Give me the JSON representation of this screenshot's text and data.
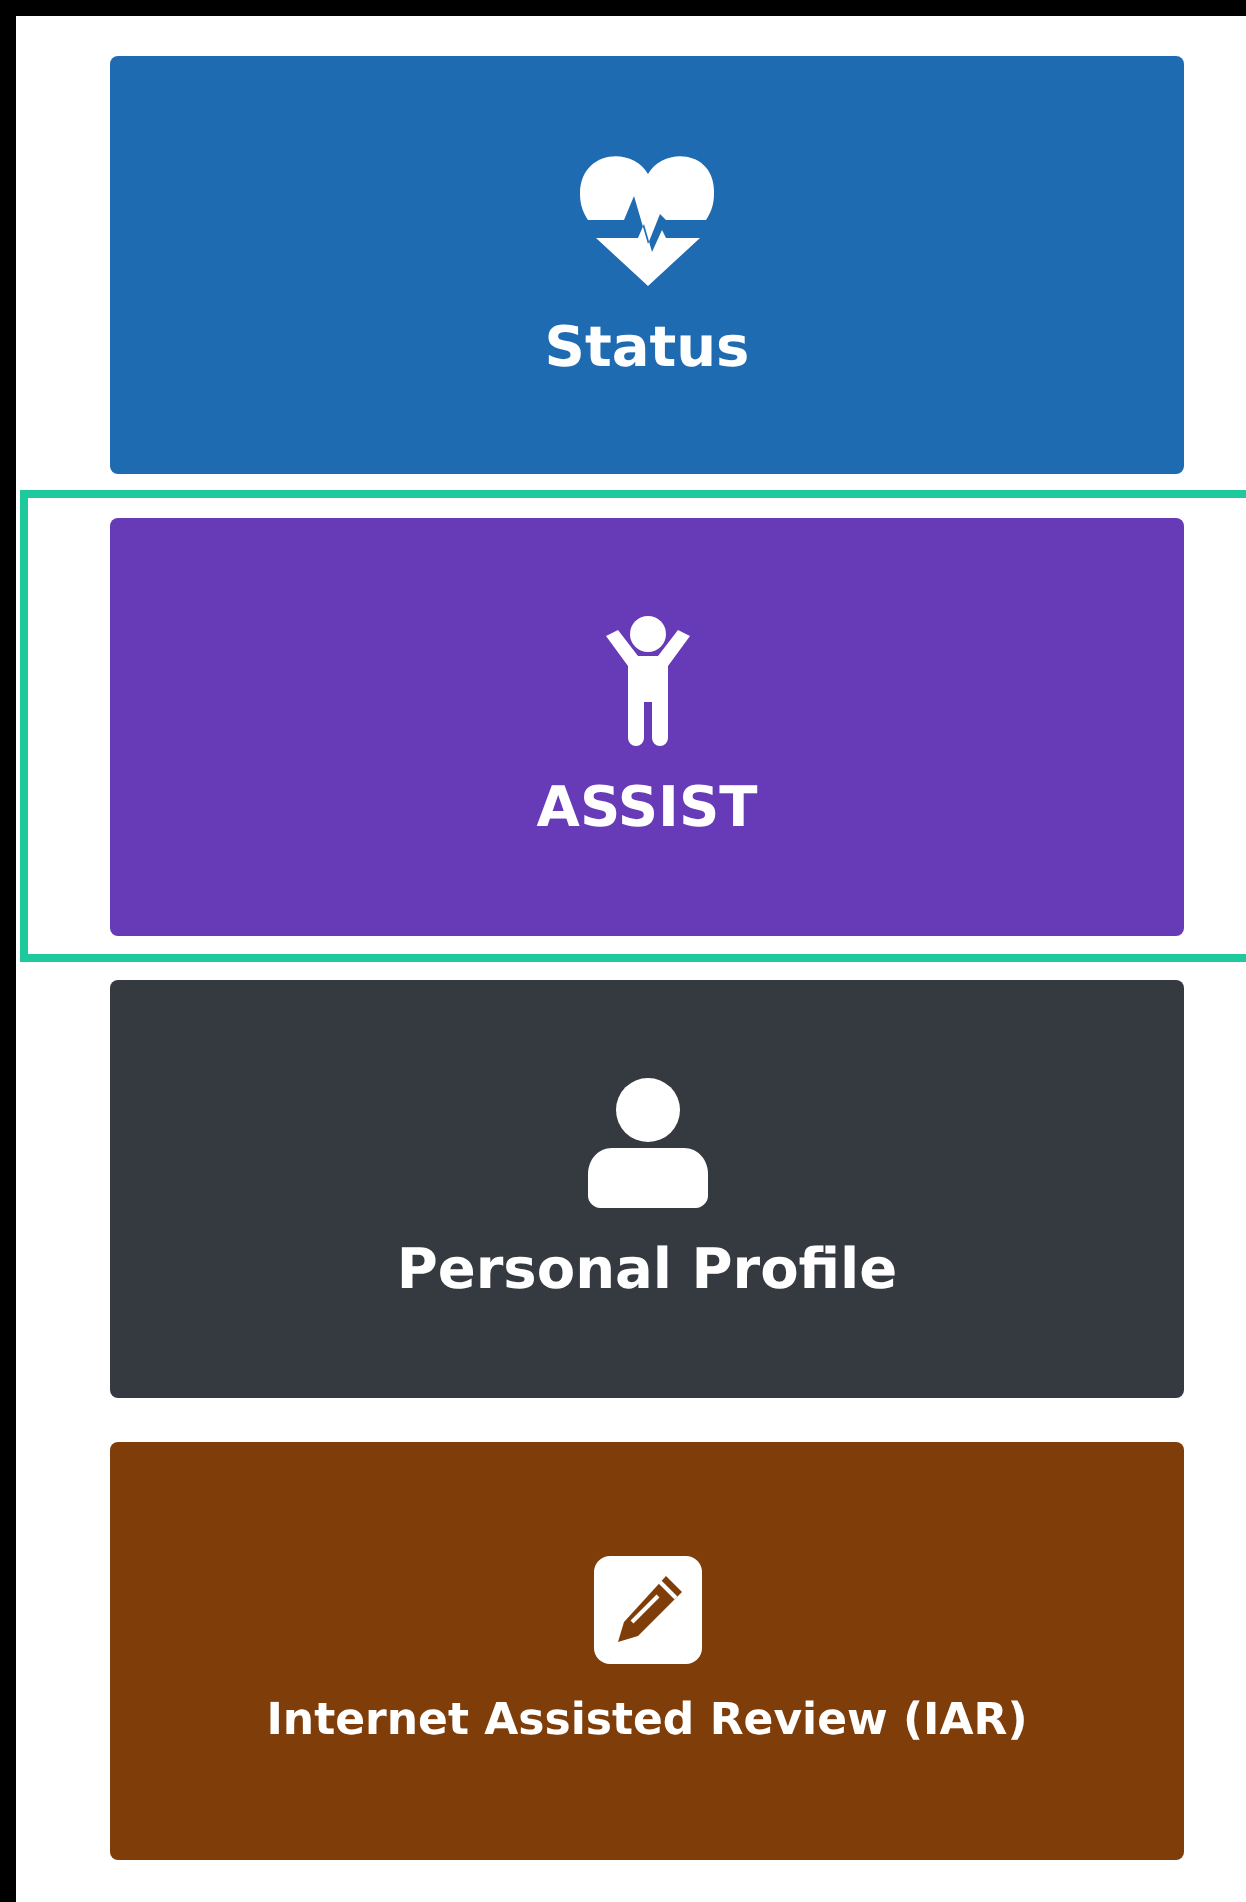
{
  "tiles": [
    {
      "kind": "health",
      "label": "Status",
      "color": "#1f6bb1",
      "selected": false
    },
    {
      "kind": "child",
      "label": "ASSIST",
      "color": "#673ab7",
      "selected": true
    },
    {
      "kind": "person",
      "label": "Personal Profile",
      "color": "#343a40",
      "selected": false
    },
    {
      "kind": "edit",
      "label": "Internet Assisted Review (IAR)",
      "color": "#7f3d0a",
      "selected": false
    }
  ]
}
